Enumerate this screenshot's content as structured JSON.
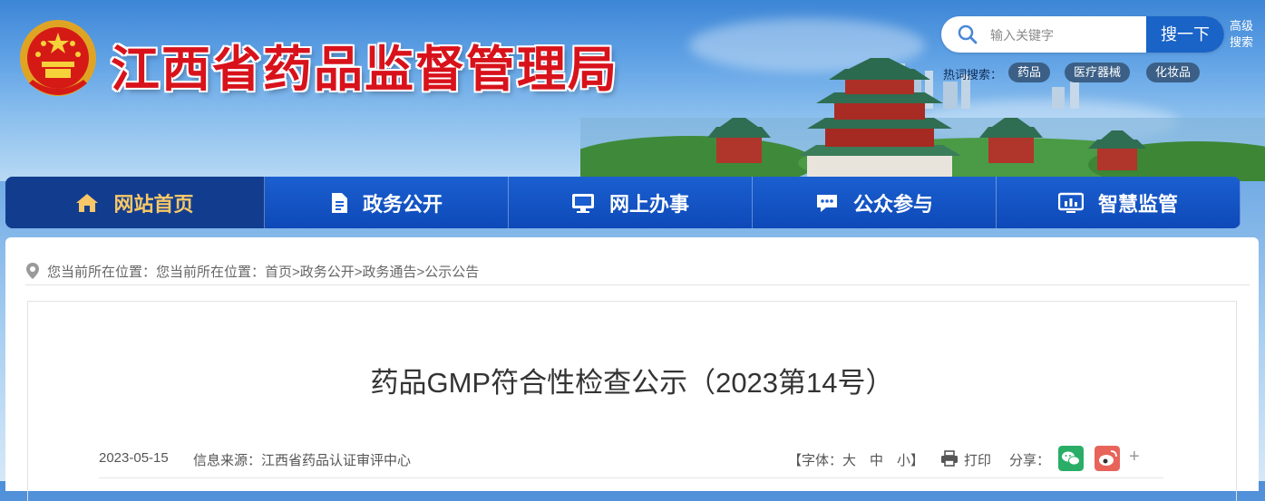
{
  "header": {
    "site_title": "江西省药品监督管理局",
    "search": {
      "placeholder": "输入关键字",
      "button_label": "搜一下",
      "advanced_label": "高级搜索"
    },
    "hot_search": {
      "label": "热词搜索：",
      "tags": [
        "药品",
        "医疗器械",
        "化妆品"
      ]
    }
  },
  "nav": {
    "items": [
      {
        "label": "网站首页",
        "icon": "home-icon"
      },
      {
        "label": "政务公开",
        "icon": "document-icon"
      },
      {
        "label": "网上办事",
        "icon": "monitor-icon"
      },
      {
        "label": "公众参与",
        "icon": "chat-icon"
      },
      {
        "label": "智慧监管",
        "icon": "dashboard-icon"
      }
    ]
  },
  "breadcrumb": {
    "prefix": "您当前所在位置：",
    "path": "您当前所在位置：首页>政务公开>政务通告>公示公告"
  },
  "article": {
    "title": "药品GMP符合性检查公示（2023第14号）",
    "date": "2023-05-15",
    "source": "信息来源：江西省药品认证审评中心",
    "font_size_label": "【字体：大　中　小】",
    "print_label": "打印",
    "share_label": "分享：",
    "more_label": "+"
  },
  "colors": {
    "brand_blue": "#1a63c7",
    "title_red": "#d8121b",
    "nav_active_text": "#f7c768",
    "wechat_green": "#2aae67",
    "weibo_red": "#e8645a"
  }
}
